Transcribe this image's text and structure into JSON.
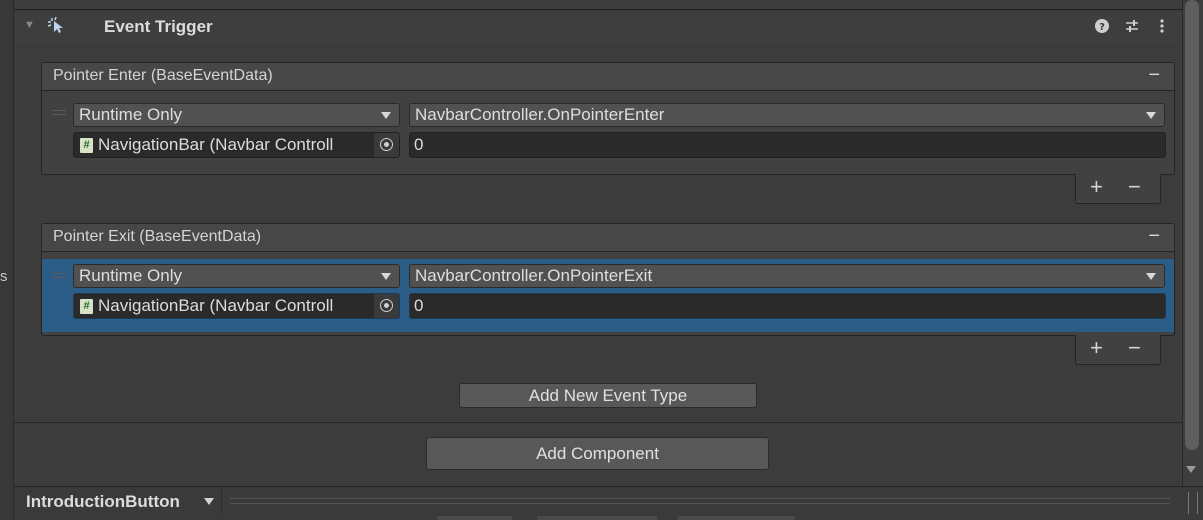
{
  "left_gutter": {
    "label": "s"
  },
  "component": {
    "title": "Event Trigger",
    "icons": [
      "help-icon",
      "preset-icon",
      "kebab-menu-icon"
    ]
  },
  "events": [
    {
      "title": "Pointer Enter (BaseEventData)",
      "remove_label": "−",
      "call_state": "Runtime Only",
      "function": "NavbarController.OnPointerEnter",
      "target": "NavigationBar (Navbar Controll",
      "argument": "0",
      "selected": false,
      "add_label": "+",
      "del_label": "−"
    },
    {
      "title": "Pointer Exit (BaseEventData)",
      "remove_label": "−",
      "call_state": "Runtime Only",
      "function": "NavbarController.OnPointerExit",
      "target": "NavigationBar (Navbar Controll",
      "argument": "0",
      "selected": true,
      "add_label": "+",
      "del_label": "−"
    }
  ],
  "add_event_button": "Add New Event Type",
  "add_component_button": "Add Component",
  "bottom_bar": {
    "title": "IntroductionButton"
  },
  "colors": {
    "selection": "#2c5d87",
    "background": "#3c3c3c"
  }
}
